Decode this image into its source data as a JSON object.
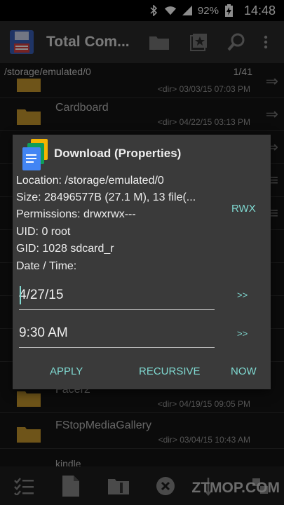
{
  "status_bar": {
    "battery": "92%",
    "time": "14:48"
  },
  "app_bar": {
    "title": "Total Com..."
  },
  "path_bar": {
    "path": "/storage/emulated/0",
    "count": "1/41"
  },
  "files": [
    {
      "name": "",
      "meta": "<dir>  03/03/15  07:03 PM"
    },
    {
      "name": "Cardboard",
      "meta": "<dir>  04/22/15  03:13 PM"
    },
    {
      "name": "",
      "meta": ""
    },
    {
      "name": "",
      "meta": ""
    },
    {
      "name": "",
      "meta": ""
    },
    {
      "name": "",
      "meta": ""
    },
    {
      "name": "",
      "meta": ""
    },
    {
      "name": "",
      "meta": ""
    },
    {
      "name": "",
      "meta": ""
    },
    {
      "name": "Facer2",
      "meta": "<dir>  04/19/15  09:05 PM"
    },
    {
      "name": "FStopMediaGallery",
      "meta": "<dir>  03/04/15  10:43 AM"
    },
    {
      "name": "kindle",
      "meta": ""
    }
  ],
  "dialog": {
    "title": "Download (Properties)",
    "location": "Location: /storage/emulated/0",
    "size": "Size: 28496577B (27.1 M), 13 file(...",
    "permissions": "Permissions: drwxrwx---",
    "uid": "UID: 0 root",
    "gid": "GID: 1028 sdcard_r",
    "datetime_label": "Date / Time:",
    "rwx_label": "RWX",
    "date_value": "4/27/15",
    "time_value": "9:30 AM",
    "date_arrow": ">>",
    "time_arrow": ">>",
    "apply_label": "APPLY",
    "recursive_label": "RECURSIVE",
    "now_label": "NOW"
  },
  "watermark": "ZTMOP.COM",
  "colors": {
    "accent": "#7fd8d0",
    "folder": "#c99a2e",
    "dialog_bg": "#3a3a3a"
  }
}
